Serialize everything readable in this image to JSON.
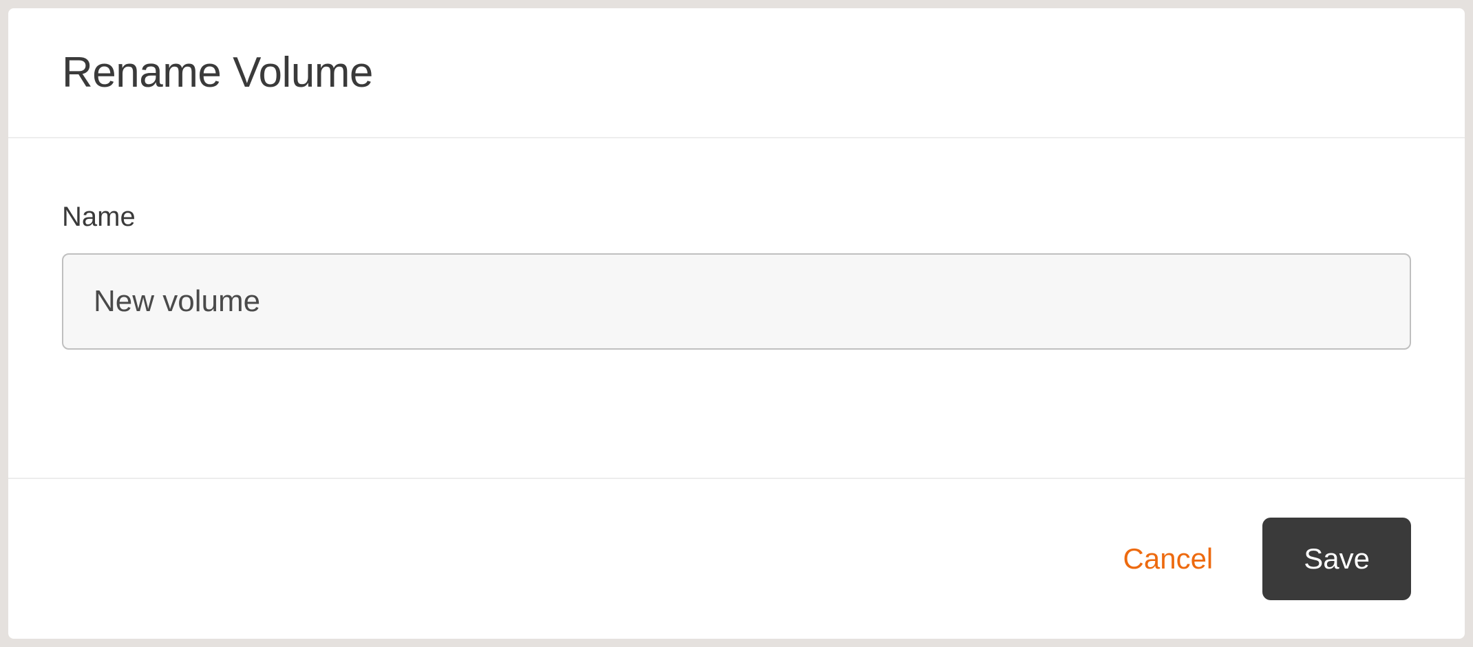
{
  "dialog": {
    "title": "Rename Volume",
    "fields": {
      "name": {
        "label": "Name",
        "value": "New volume"
      }
    },
    "actions": {
      "cancel_label": "Cancel",
      "save_label": "Save"
    }
  }
}
